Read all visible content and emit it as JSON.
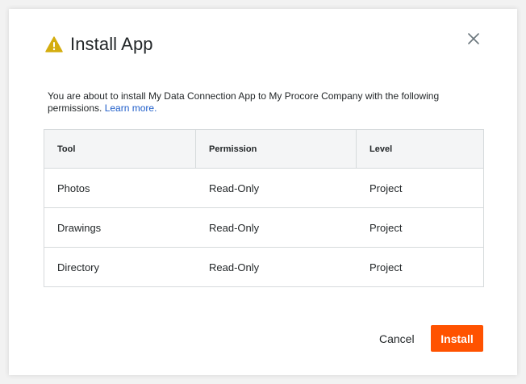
{
  "dialog": {
    "title": "Install App",
    "icons": {
      "warning": "warning-triangle-icon",
      "close": "close-x-icon"
    },
    "message_prefix": "You are about to install My Data Connection App to My Procore Company with the following permissions.",
    "learn_more": "Learn more.",
    "table": {
      "headers": [
        "Tool",
        "Permission",
        "Level"
      ],
      "rows": [
        [
          "Photos",
          "Read-Only",
          "Project"
        ],
        [
          "Drawings",
          "Read-Only",
          "Project"
        ],
        [
          "Directory",
          "Read-Only",
          "Project"
        ]
      ]
    },
    "buttons": {
      "cancel": "Cancel",
      "install": "Install"
    },
    "colors": {
      "warning": "#d4ad0f",
      "primary": "#ff5200",
      "link": "#1d5cc9"
    }
  }
}
